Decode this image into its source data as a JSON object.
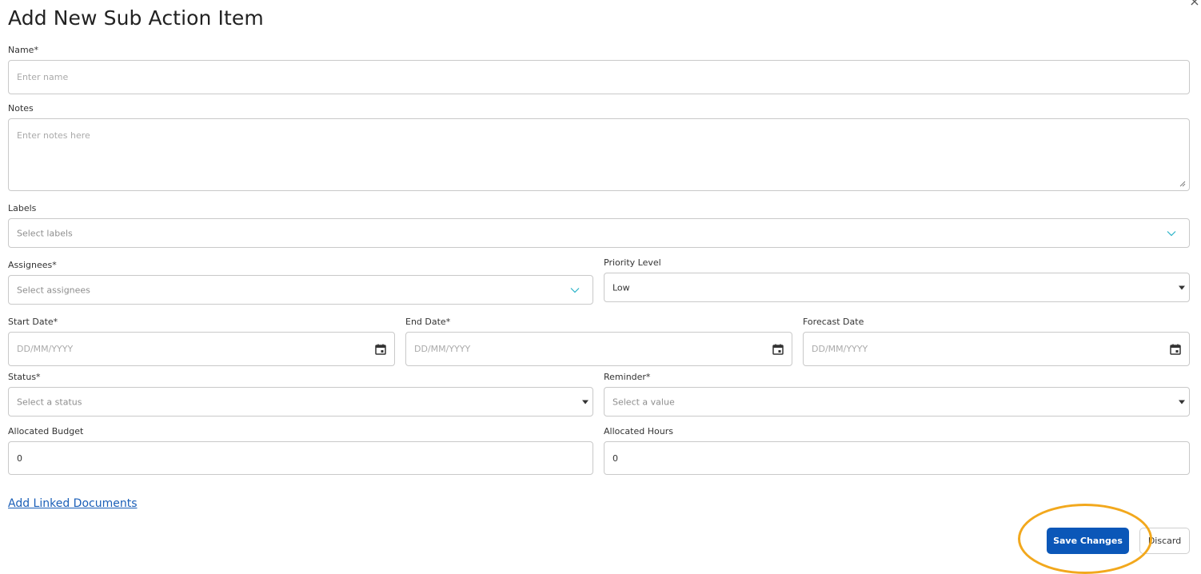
{
  "dialog": {
    "title": "Add New Sub Action Item",
    "close_glyph": "×"
  },
  "form": {
    "name": {
      "label": "Name*",
      "placeholder": "Enter name"
    },
    "notes": {
      "label": "Notes",
      "placeholder": "Enter notes here"
    },
    "labels": {
      "label": "Labels",
      "placeholder": "Select labels"
    },
    "assignees": {
      "label": "Assignees*",
      "placeholder": "Select assignees"
    },
    "priority_level": {
      "label": "Priority Level",
      "value": "Low"
    },
    "start_date": {
      "label": "Start Date*",
      "placeholder": "DD/MM/YYYY"
    },
    "end_date": {
      "label": "End Date*",
      "placeholder": "DD/MM/YYYY"
    },
    "forecast_date": {
      "label": "Forecast Date",
      "placeholder": "DD/MM/YYYY"
    },
    "status": {
      "label": "Status*",
      "placeholder": "Select a status"
    },
    "reminder": {
      "label": "Reminder*",
      "placeholder": "Select a value"
    },
    "allocated_budget": {
      "label": "Allocated Budget",
      "value": "0"
    },
    "allocated_hours": {
      "label": "Allocated Hours",
      "value": "0"
    }
  },
  "links": {
    "add_linked_documents": "Add Linked Documents"
  },
  "actions": {
    "save_label": "Save Changes",
    "discard_label": "Discard"
  },
  "colors": {
    "primary": "#0b57b8",
    "link": "#1b5fb8",
    "highlight": "#f2a81d",
    "chevron": "#2bb3c8"
  },
  "icons": {
    "close": "close-icon",
    "multiselect_toggle": "chevron-down-icon",
    "dropdown_toggle": "caret-down-icon",
    "date_picker": "calendar-icon"
  }
}
